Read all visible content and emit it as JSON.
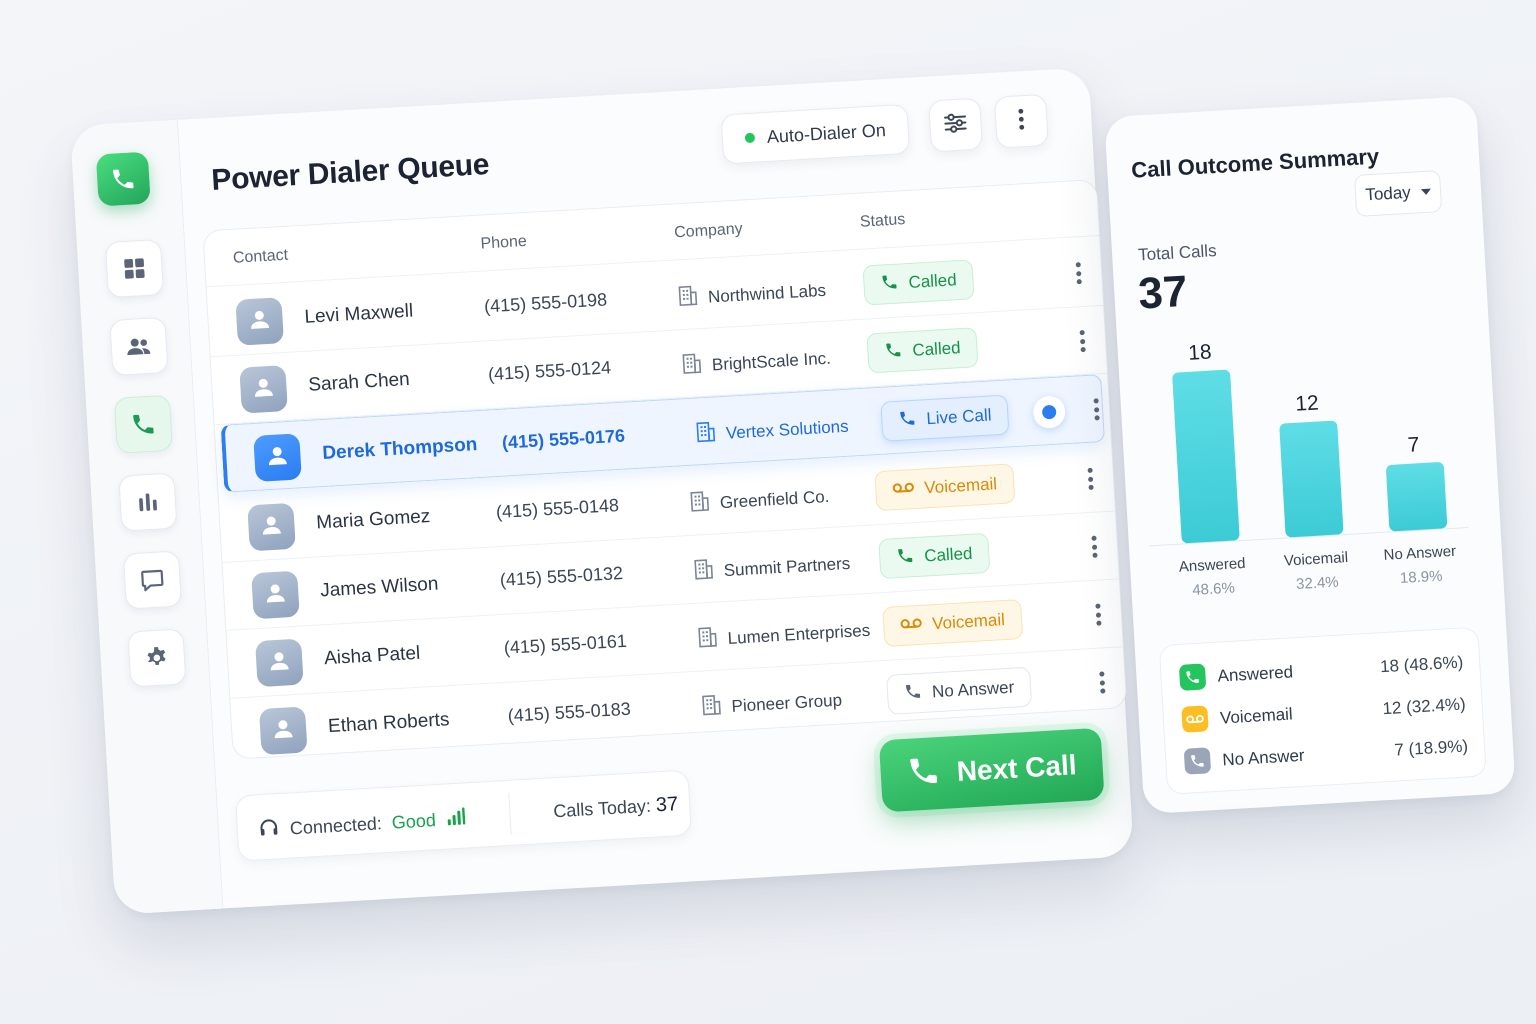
{
  "dialer": {
    "title": "Power Dialer Queue",
    "auto_dialer_label": "Auto-Dialer On",
    "columns": {
      "contact": "Contact",
      "phone": "Phone",
      "company": "Company",
      "status": "Status"
    },
    "rows": [
      {
        "name": "Levi Maxwell",
        "phone": "(415) 555-0198",
        "company": "Northwind Labs",
        "status": "Called"
      },
      {
        "name": "Sarah Chen",
        "phone": "(415) 555-0124",
        "company": "BrightScale Inc.",
        "status": "Called"
      },
      {
        "name": "Derek Thompson",
        "phone": "(415) 555-0176",
        "company": "Vertex Solutions",
        "status": "Live Call"
      },
      {
        "name": "Maria Gomez",
        "phone": "(415) 555-0148",
        "company": "Greenfield Co.",
        "status": "Voicemail"
      },
      {
        "name": "James Wilson",
        "phone": "(415) 555-0132",
        "company": "Summit Partners",
        "status": "Called"
      },
      {
        "name": "Aisha Patel",
        "phone": "(415) 555-0161",
        "company": "Lumen Enterprises",
        "status": "Voicemail"
      },
      {
        "name": "Ethan Roberts",
        "phone": "(415) 555-0183",
        "company": "Pioneer Group",
        "status": "No Answer"
      }
    ],
    "footer": {
      "connected_label": "Connected:",
      "connected_value": "Good",
      "calls_today_label": "Calls Today:",
      "calls_today_value": "37"
    },
    "next_call_label": "Next Call"
  },
  "summary": {
    "title": "Call Outcome Summary",
    "period": "Today",
    "total_label": "Total Calls",
    "total_value": "37",
    "legend": [
      {
        "label": "Answered",
        "value": "18 (48.6%)"
      },
      {
        "label": "Voicemail",
        "value": "12 (32.4%)"
      },
      {
        "label": "No Answer",
        "value": "7 (18.9%)"
      }
    ]
  },
  "chart_data": {
    "type": "bar",
    "categories": [
      "Answered",
      "Voicemail",
      "No Answer"
    ],
    "values": [
      18,
      12,
      7
    ],
    "percent_labels": [
      "48.6%",
      "32.4%",
      "18.9%"
    ],
    "ylim": [
      0,
      20
    ],
    "grid": false,
    "legend": "none",
    "color": "#3ccbd6"
  },
  "colors": {
    "accent_green": "#22c55e",
    "live_blue": "#2b7df0",
    "voicemail_amber": "#f59e0b",
    "bar_teal": "#3ccbd6"
  },
  "icons": {
    "logo": "phone-icon",
    "nav": [
      "grid-icon",
      "users-icon",
      "phone-icon",
      "bar-chart-icon",
      "chat-icon",
      "gear-icon"
    ]
  }
}
